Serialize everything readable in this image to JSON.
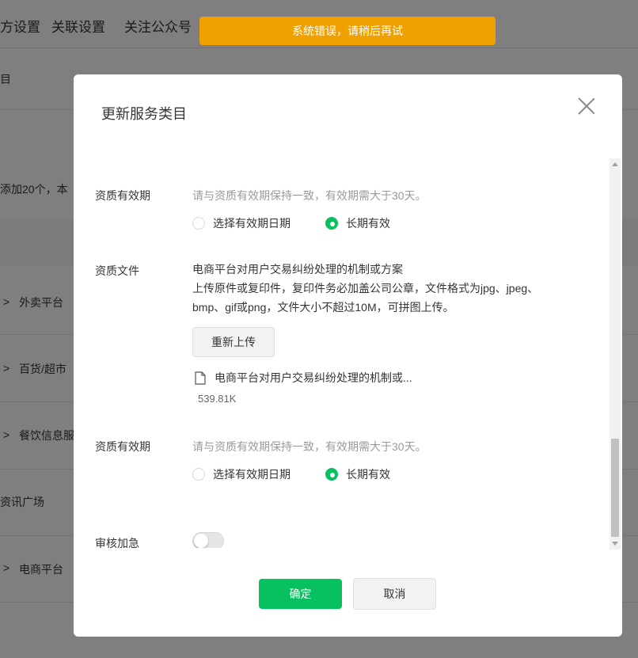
{
  "background": {
    "tabs": [
      "方设置",
      "关联设置",
      "关注公众号"
    ],
    "rows": [
      "目",
      "添加20个，本",
      "外卖平台",
      "百货/超市",
      "餐饮信息服",
      "资讯广场",
      "电商平台"
    ]
  },
  "toast": {
    "message": "系统错误，请稍后再试",
    "color": "#f0a000"
  },
  "dialog": {
    "title": "更新服务类目",
    "section1": {
      "label": "资质有效期",
      "hint": "请与资质有效期保持一致，有效期需大于30天。",
      "options": [
        "选择有效期日期",
        "长期有效"
      ],
      "selected": "长期有效"
    },
    "section2": {
      "label": "资质文件",
      "desc_lines": [
        "电商平台对用户交易纠纷处理的机制或方案",
        "上传原件或复印件，复印件务必加盖公司公章，文件格式为jpg、jpeg、",
        "bmp、gif或png，文件大小不超过10M，可拼图上传。"
      ],
      "upload_label": "重新上传",
      "file_name": "电商平台对用户交易纠纷处理的机制或...",
      "file_size": "539.81K"
    },
    "section3": {
      "label": "资质有效期",
      "hint": "请与资质有效期保持一致，有效期需大于30天。",
      "options": [
        "选择有效期日期",
        "长期有效"
      ],
      "selected": "长期有效"
    },
    "urgent": {
      "label": "审核加急",
      "enabled": false
    },
    "confirm_label": "确定",
    "cancel_label": "取消",
    "accent_color": "#07c160"
  }
}
